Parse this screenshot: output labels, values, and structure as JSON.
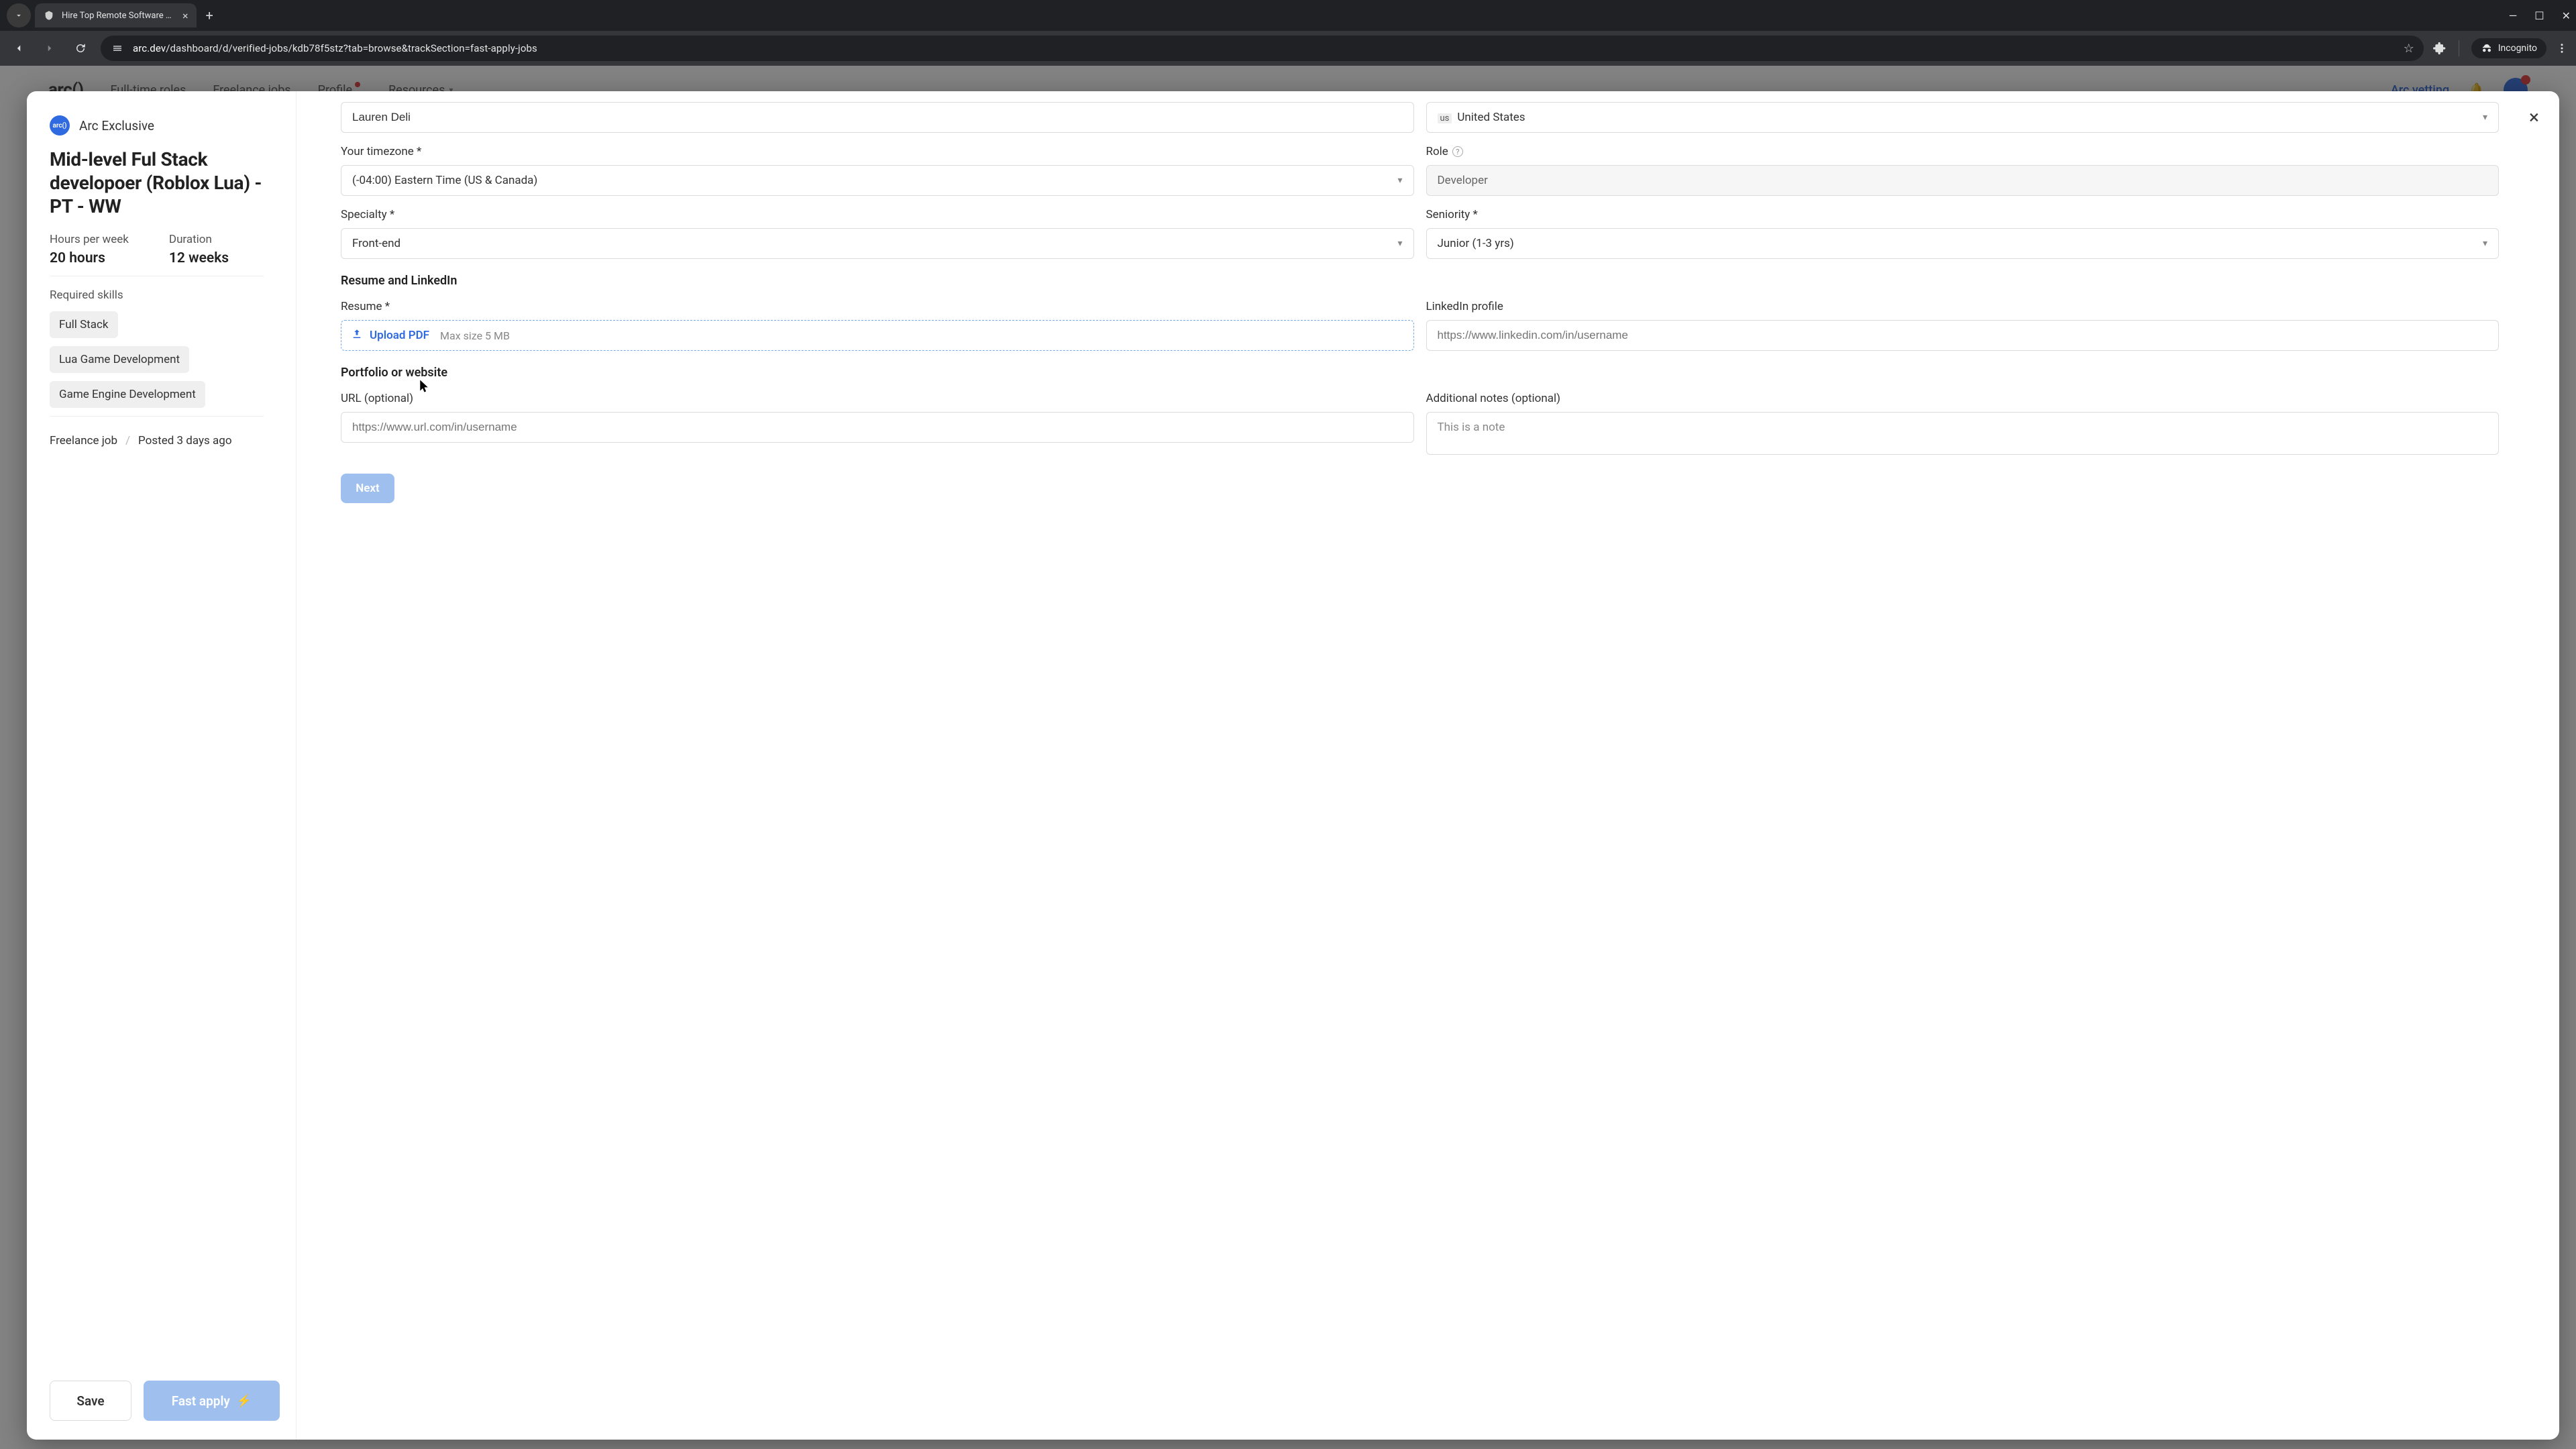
{
  "browser": {
    "tab_title": "Hire Top Remote Software Dev…",
    "url_host": "arc.dev",
    "url_path": "/dashboard/d/verified-jobs/kdb78f5stz?tab=browse&trackSection=fast-apply-jobs",
    "incognito_label": "Incognito"
  },
  "backnav": {
    "logo": "arc()",
    "items": [
      "Full-time roles",
      "Freelance jobs",
      "Profile",
      "Resources"
    ],
    "right_cta": "Arc vetting"
  },
  "modal": {
    "brand": "Arc Exclusive",
    "brand_logo_text": "arc()",
    "job_title": "Mid-level Ful Stack developoer (Roblox Lua) - PT - WW",
    "meta": {
      "hours_label": "Hours per week",
      "hours_value": "20 hours",
      "duration_label": "Duration",
      "duration_value": "12 weeks"
    },
    "required_label": "Required skills",
    "skills": [
      "Full Stack",
      "Lua Game Development",
      "Game Engine Development"
    ],
    "job_type": "Freelance job",
    "posted": "Posted 3 days ago",
    "save_label": "Save",
    "fast_apply_label": "Fast apply"
  },
  "form": {
    "name_value": "Lauren Deli",
    "country_flag": "us",
    "country_value": "United States",
    "tz_label": "Your timezone *",
    "tz_value": "(-04:00) Eastern Time (US & Canada)",
    "role_label": "Role",
    "role_value": "Developer",
    "specialty_label": "Specialty *",
    "specialty_value": "Front-end",
    "seniority_label": "Seniority *",
    "seniority_value": "Junior (1-3 yrs)",
    "resume_section": "Resume and LinkedIn",
    "resume_label": "Resume *",
    "upload_label": "Upload PDF",
    "upload_hint": "Max size 5 MB",
    "linkedin_label": "LinkedIn profile",
    "linkedin_placeholder": "https://www.linkedin.com/in/username",
    "portfolio_section": "Portfolio or website",
    "url_label": "URL (optional)",
    "url_placeholder": "https://www.url.com/in/username",
    "notes_label": "Additional notes (optional)",
    "notes_placeholder": "This is a note",
    "next_label": "Next"
  }
}
